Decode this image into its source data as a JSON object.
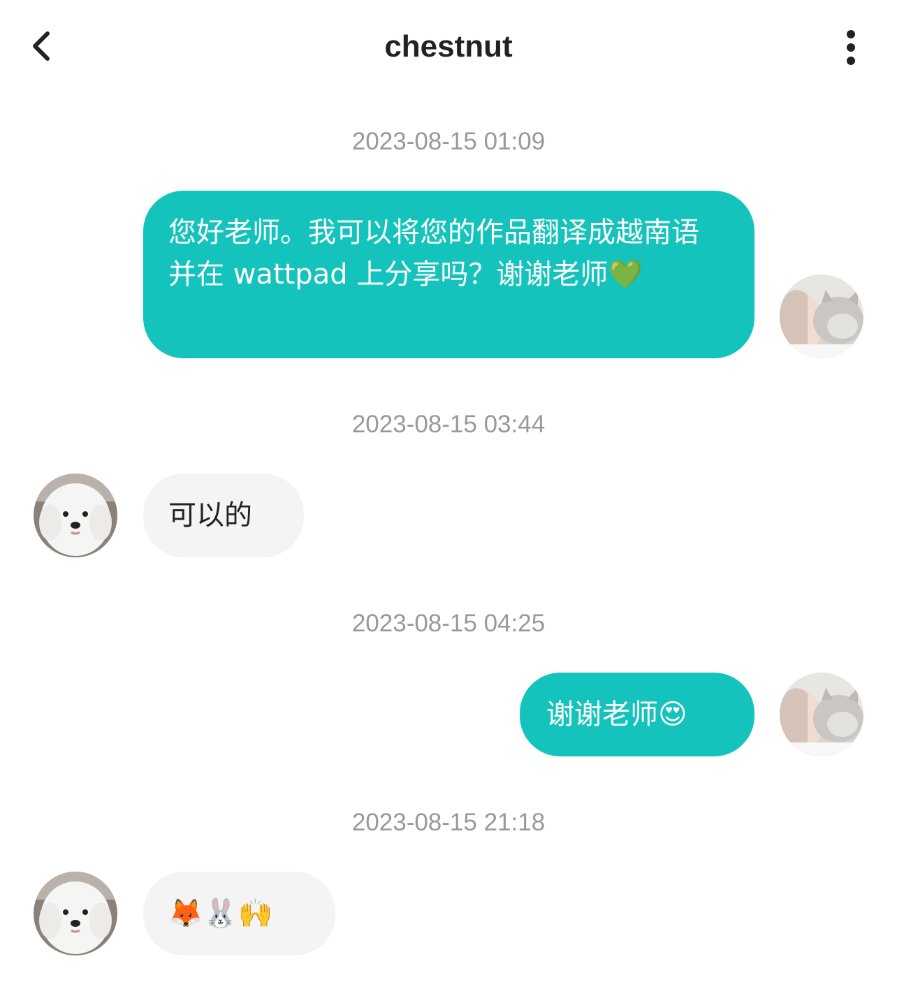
{
  "header": {
    "title": "chestnut",
    "back_icon": "chevron-left-icon",
    "more_icon": "more-vertical-icon"
  },
  "messages": [
    {
      "timestamp": "2023-08-15 01:09",
      "direction": "outgoing",
      "text": "您好老师。我可以将您的作品翻译成越南语并在 wattpad 上分享吗？谢谢老师💚"
    },
    {
      "timestamp": "2023-08-15 03:44",
      "direction": "incoming",
      "text": "可以的"
    },
    {
      "timestamp": "2023-08-15 04:25",
      "direction": "outgoing",
      "text": "谢谢老师😍"
    },
    {
      "timestamp": "2023-08-15 21:18",
      "direction": "incoming",
      "text": "🦊🐰🙌"
    }
  ],
  "colors": {
    "outgoing_bubble": "#15c3bd",
    "incoming_bubble": "#f4f4f4",
    "timestamp_text": "#999999"
  }
}
